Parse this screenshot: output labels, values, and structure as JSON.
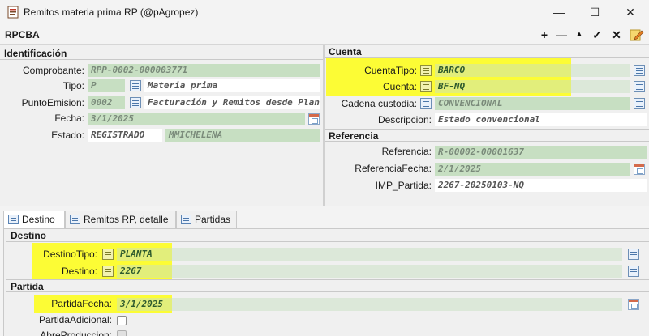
{
  "window": {
    "title": "Remitos materia prima RP (@pAgropez)",
    "minimize_glyph": "—",
    "maximize_glyph": "☐",
    "close_glyph": "✕"
  },
  "toolbar": {
    "code": "RPCBA",
    "add_glyph": "+",
    "remove_glyph": "—",
    "up_glyph": "▲",
    "ok_glyph": "✓",
    "cancel_glyph": "✕"
  },
  "identificacion": {
    "header": "Identificación",
    "comprobante": {
      "label": "Comprobante:",
      "value": "RPP-0002-000003771"
    },
    "tipo": {
      "label": "Tipo:",
      "code": "P",
      "desc": "Materia prima"
    },
    "punto_emision": {
      "label": "PuntoEmision:",
      "code": "0002",
      "desc": "Facturación y Remitos desde Planilla"
    },
    "fecha": {
      "label": "Fecha:",
      "value": "3/1/2025"
    },
    "estado": {
      "label": "Estado:",
      "value": "REGISTRADO",
      "user": "MMICHELENA"
    }
  },
  "cuenta": {
    "header": "Cuenta",
    "cuenta_tipo": {
      "label": "CuentaTipo:",
      "value": "BARCO"
    },
    "cuenta": {
      "label": "Cuenta:",
      "value": "BF-NQ"
    },
    "cadena_custodia": {
      "label": "Cadena custodia:",
      "value": "CONVENCIONAL"
    },
    "descripcion": {
      "label": "Descripcion:",
      "value": "Estado convencional"
    }
  },
  "referencia": {
    "header": "Referencia",
    "referencia": {
      "label": "Referencia:",
      "value": "R-00002-00001637"
    },
    "referencia_fecha": {
      "label": "ReferenciaFecha:",
      "value": "2/1/2025"
    },
    "imp_partida": {
      "label": "IMP_Partida:",
      "value": "2267-20250103-NQ"
    }
  },
  "tabs": [
    {
      "label": "Destino"
    },
    {
      "label": "Remitos RP, detalle"
    },
    {
      "label": "Partidas"
    }
  ],
  "destino": {
    "header": "Destino",
    "destino_tipo": {
      "label": "DestinoTipo:",
      "value": "PLANTA"
    },
    "destino": {
      "label": "Destino:",
      "value": "2267"
    }
  },
  "partida": {
    "header": "Partida",
    "partida_fecha": {
      "label": "PartidaFecha:",
      "value": "3/1/2025"
    },
    "partida_adicional": {
      "label": "PartidaAdicional:"
    },
    "abre_produccion": {
      "label": "AbreProduccion:"
    }
  },
  "colors": {
    "field_green": "#c7dfc2",
    "highlight": "#ffff00",
    "lookup_blue": "#4c77aa"
  }
}
